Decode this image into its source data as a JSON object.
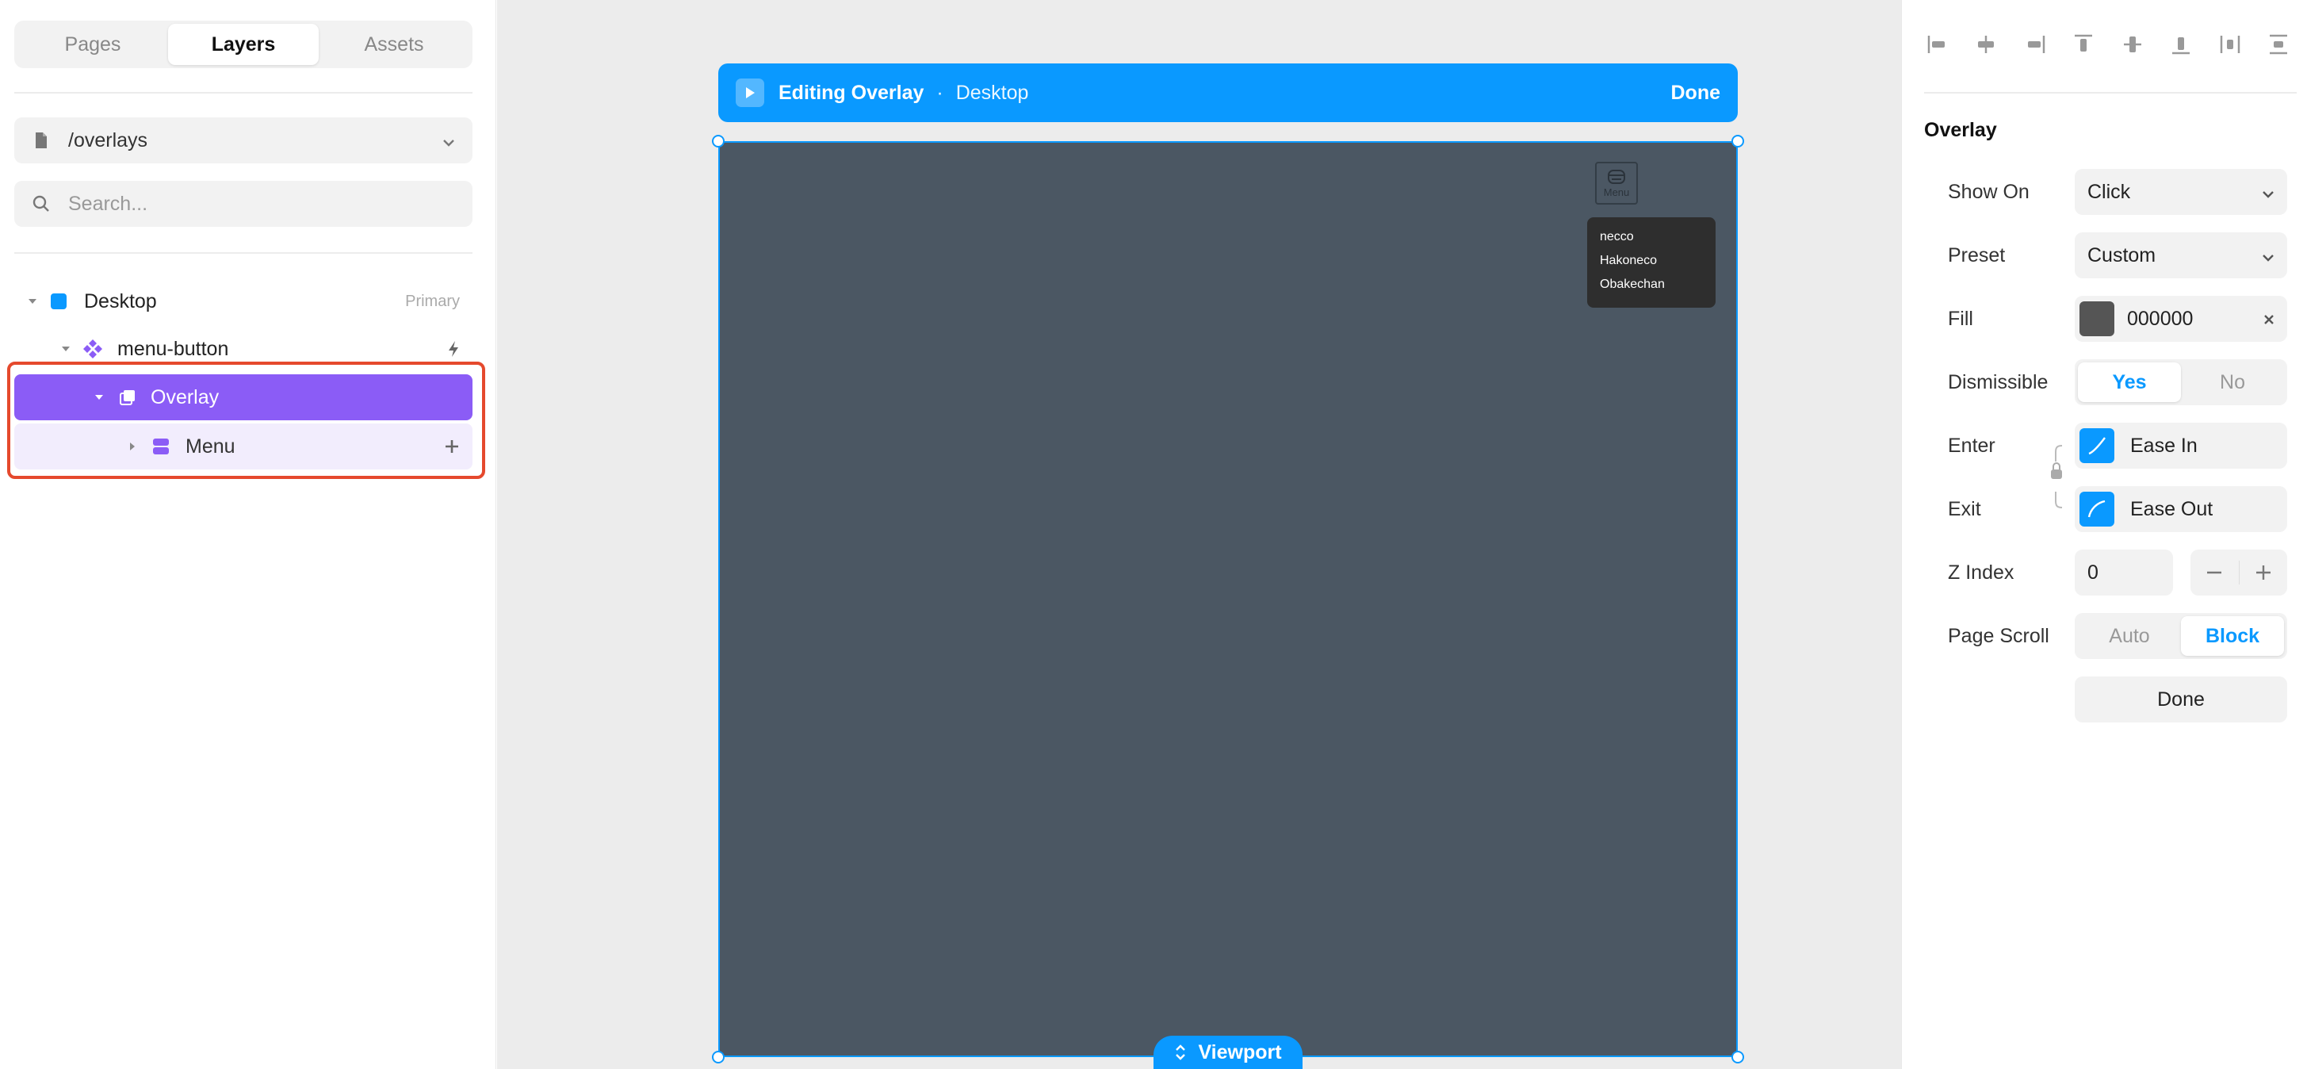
{
  "left_panel": {
    "tabs": [
      "Pages",
      "Layers",
      "Assets"
    ],
    "active_tab": "Layers",
    "page_select": {
      "value": "/overlays"
    },
    "search": {
      "placeholder": "Search..."
    },
    "layers": [
      {
        "label": "Desktop",
        "badge": "Primary",
        "icon": "frame-icon",
        "color": "#0a99ff"
      },
      {
        "label": "menu-button",
        "icon": "component-icon",
        "color": "#8b5cf6",
        "action_icon": "lightning-icon"
      },
      {
        "label": "Overlay",
        "icon": "overlay-icon",
        "selected": true,
        "color": "#8b5cf6"
      },
      {
        "label": "Menu",
        "icon": "stack-icon",
        "color": "#8b5cf6",
        "action_icon": "plus-icon"
      }
    ]
  },
  "canvas": {
    "topbar": {
      "title": "Editing Overlay",
      "separator": "·",
      "breadcrumb": "Desktop",
      "done_label": "Done"
    },
    "frame_bg": "#4b5763",
    "menu_button_label": "Menu",
    "menu_items": [
      "necco",
      "Hakoneco",
      "Obakechan"
    ],
    "viewport_label": "Viewport",
    "accent": "#0a99ff"
  },
  "right_panel": {
    "section_title": "Overlay",
    "show_on": {
      "label": "Show On",
      "value": "Click"
    },
    "preset": {
      "label": "Preset",
      "value": "Custom"
    },
    "fill": {
      "label": "Fill",
      "value": "000000"
    },
    "dismissible": {
      "label": "Dismissible",
      "options": [
        "Yes",
        "No"
      ],
      "selected": "Yes"
    },
    "enter": {
      "label": "Enter",
      "value": "Ease In"
    },
    "exit": {
      "label": "Exit",
      "value": "Ease Out"
    },
    "z_index": {
      "label": "Z Index",
      "value": "0"
    },
    "page_scroll": {
      "label": "Page Scroll",
      "options": [
        "Auto",
        "Block"
      ],
      "selected": "Block"
    },
    "done_label": "Done"
  }
}
